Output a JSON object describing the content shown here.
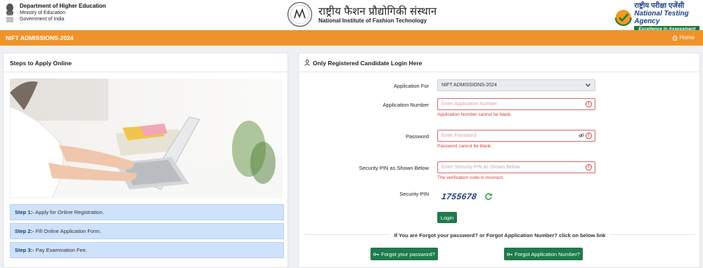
{
  "header": {
    "dept_title": "Department of Higher Education",
    "ministry": "Ministry of Education",
    "government": "Government of India",
    "nift_hindi": "राष्ट्रीय फैशन प्रौद्योगिकी संस्थान",
    "nift_english": "National Institute of Fashion Technology",
    "nta_hindi": "राष्ट्रीय परीक्षा एजेंसी",
    "nta_english": "National Testing Agency",
    "nta_tagline": "Excellence in Assessment"
  },
  "navbar": {
    "title": "NIFT ADMISSIONS-2024",
    "home_label": "Home"
  },
  "steps_panel": {
    "heading": "Steps to Apply Online",
    "steps": [
      {
        "prefix": "Step 1:-",
        "text": " Apply for Online Registration."
      },
      {
        "prefix": "Step 2:-",
        "text": " Fill Online Application Form."
      },
      {
        "prefix": "Step 3:-",
        "text": " Pay Examination Fee."
      }
    ]
  },
  "login_panel": {
    "heading": "Only Registered Candidate Login Here",
    "application_for": {
      "label": "Application For",
      "value": "NIFT ADMISSIONS-2024"
    },
    "application_number": {
      "label": "Application Number",
      "placeholder": "Enter Application Number",
      "error": "Application Number cannot be blank."
    },
    "password": {
      "label": "Password",
      "placeholder": "Enter Password",
      "error": "Password cannot be blank."
    },
    "security_pin_input": {
      "label": "Security PIN as Shown Below",
      "placeholder": "Enter Security PIN as Shown Below",
      "error": "The verification code is incorrect."
    },
    "security_pin": {
      "label": "Security PIN",
      "captcha": "1755678"
    },
    "login_label": "Login",
    "forgot_text": "If You are Forgot your password? or Forgot Application Number? click on below link",
    "forgot_password_label": "Forgot your password?",
    "forgot_appno_label": "Forgot Application Number?"
  },
  "colors": {
    "accent": "#f0922b",
    "button": "#1f7a4d",
    "error": "#d43b3b",
    "step_bg": "#cfe2fb"
  }
}
